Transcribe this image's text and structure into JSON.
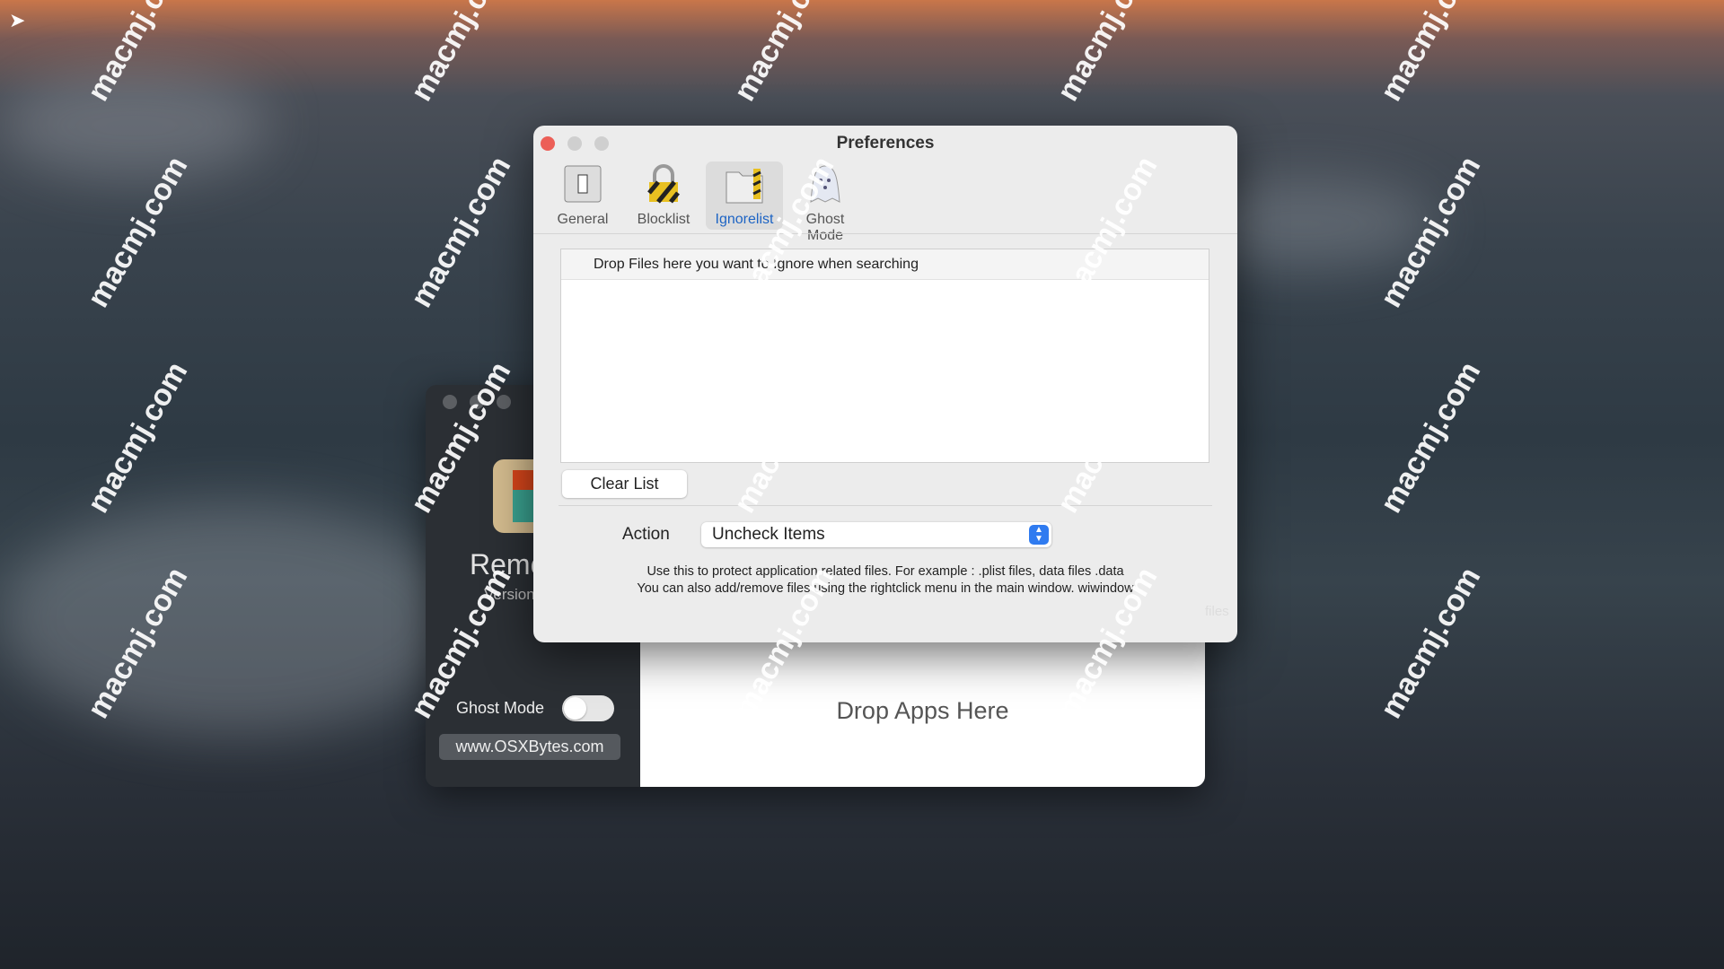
{
  "watermark": "macmj.com",
  "preferences": {
    "title": "Preferences",
    "tabs": [
      {
        "label": "General",
        "icon": "switch-icon"
      },
      {
        "label": "Blocklist",
        "icon": "padlock-icon"
      },
      {
        "label": "Ignorelist",
        "icon": "folder-hazard-icon",
        "active": true
      },
      {
        "label": "Ghost Mode",
        "icon": "ghost-icon"
      }
    ],
    "drop_header": "Drop Files here you want to Ignore when searching",
    "clear_label": "Clear List",
    "action_label": "Action",
    "action_value": "Uncheck Items",
    "help_line1": "Use this to protect application related files. For example : .plist files, data files .data",
    "help_line2": "You can also add/remove files using the rightclick menu in the main window. wiwindow",
    "overflow_text": "files"
  },
  "app": {
    "name": "Remo",
    "version": "Version",
    "ghost_mode_label": "Ghost Mode",
    "ghost_mode_on": false,
    "website": "www.OSXBytes.com",
    "drop_label": "Drop Apps Here"
  },
  "colors": {
    "accent": "#2f7bf0",
    "active_tab": "#1d64c4",
    "close": "#ec5f57"
  }
}
